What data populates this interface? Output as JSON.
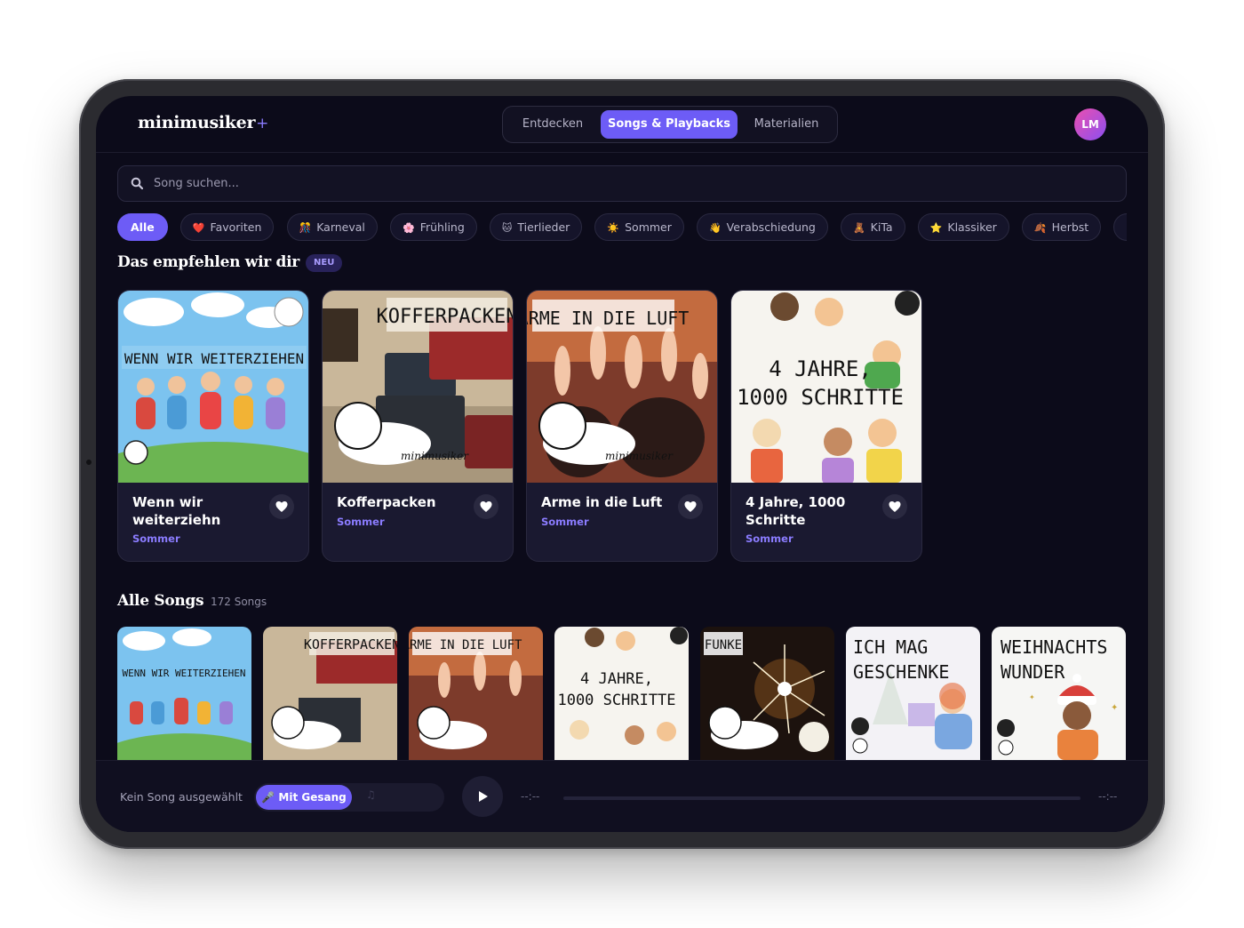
{
  "brand": {
    "name": "minimusiker",
    "suffix": "+"
  },
  "nav": {
    "tabs": [
      {
        "label": "Entdecken",
        "active": false
      },
      {
        "label": "Songs & Playbacks",
        "active": true
      },
      {
        "label": "Materialien",
        "active": false
      }
    ]
  },
  "user": {
    "initials": "LM"
  },
  "search": {
    "placeholder": "Song suchen..."
  },
  "filters": [
    {
      "label": "Alle",
      "icon": "",
      "active": true
    },
    {
      "label": "Favoriten",
      "icon": "❤️",
      "active": false
    },
    {
      "label": "Karneval",
      "icon": "🎊",
      "active": false
    },
    {
      "label": "Frühling",
      "icon": "🌸",
      "active": false
    },
    {
      "label": "Tierlieder",
      "icon": "🐱",
      "active": false
    },
    {
      "label": "Sommer",
      "icon": "☀️",
      "active": false
    },
    {
      "label": "Verabschiedung",
      "icon": "👋",
      "active": false
    },
    {
      "label": "KiTa",
      "icon": "🧸",
      "active": false
    },
    {
      "label": "Klassiker",
      "icon": "⭐",
      "active": false
    },
    {
      "label": "Herbst",
      "icon": "🍂",
      "active": false
    },
    {
      "label": "Ge",
      "icon": "🎂",
      "active": false
    }
  ],
  "recommended": {
    "title": "Das empfehlen wir dir",
    "badge": "NEU",
    "items": [
      {
        "title": "Wenn wir weiterziehn",
        "category": "Sommer",
        "art_text": "WENN WIR WEITERZIEHEN"
      },
      {
        "title": "Kofferpacken",
        "category": "Sommer",
        "art_text": "KOFFERPACKEN"
      },
      {
        "title": "Arme in die Luft",
        "category": "Sommer",
        "art_text": "ARME IN DIE LUFT"
      },
      {
        "title": "4 Jahre, 1000 Schritte",
        "category": "Sommer",
        "art_text": [
          "4 JAHRE,",
          "1000 SCHRITTE"
        ]
      }
    ]
  },
  "all_songs": {
    "title": "Alle Songs",
    "count": "172 Songs",
    "tiles": [
      {
        "art_text": "WENN WIR WEITERZIEHEN"
      },
      {
        "art_text": "KOFFERPACKEN"
      },
      {
        "art_text": "ARME IN DIE LUFT"
      },
      {
        "art_text": [
          "4 JAHRE,",
          "1000 SCHRITTE"
        ]
      },
      {
        "art_text": "FUNKE"
      },
      {
        "art_text": [
          "ICH MAG",
          "GESCHENKE"
        ]
      },
      {
        "art_text": [
          "WEIHNACHTS",
          "WUNDER"
        ]
      }
    ]
  },
  "player": {
    "status": "Kein Song ausgewählt",
    "mode_label": "Mit Gesang",
    "mode_icon": "🎤",
    "alt_mode_icon": "♫",
    "time_current": "--:--",
    "time_total": "--:--"
  },
  "colors": {
    "accent": "#6d5cf6",
    "background": "#0c0b1a",
    "card": "#1a1930"
  }
}
